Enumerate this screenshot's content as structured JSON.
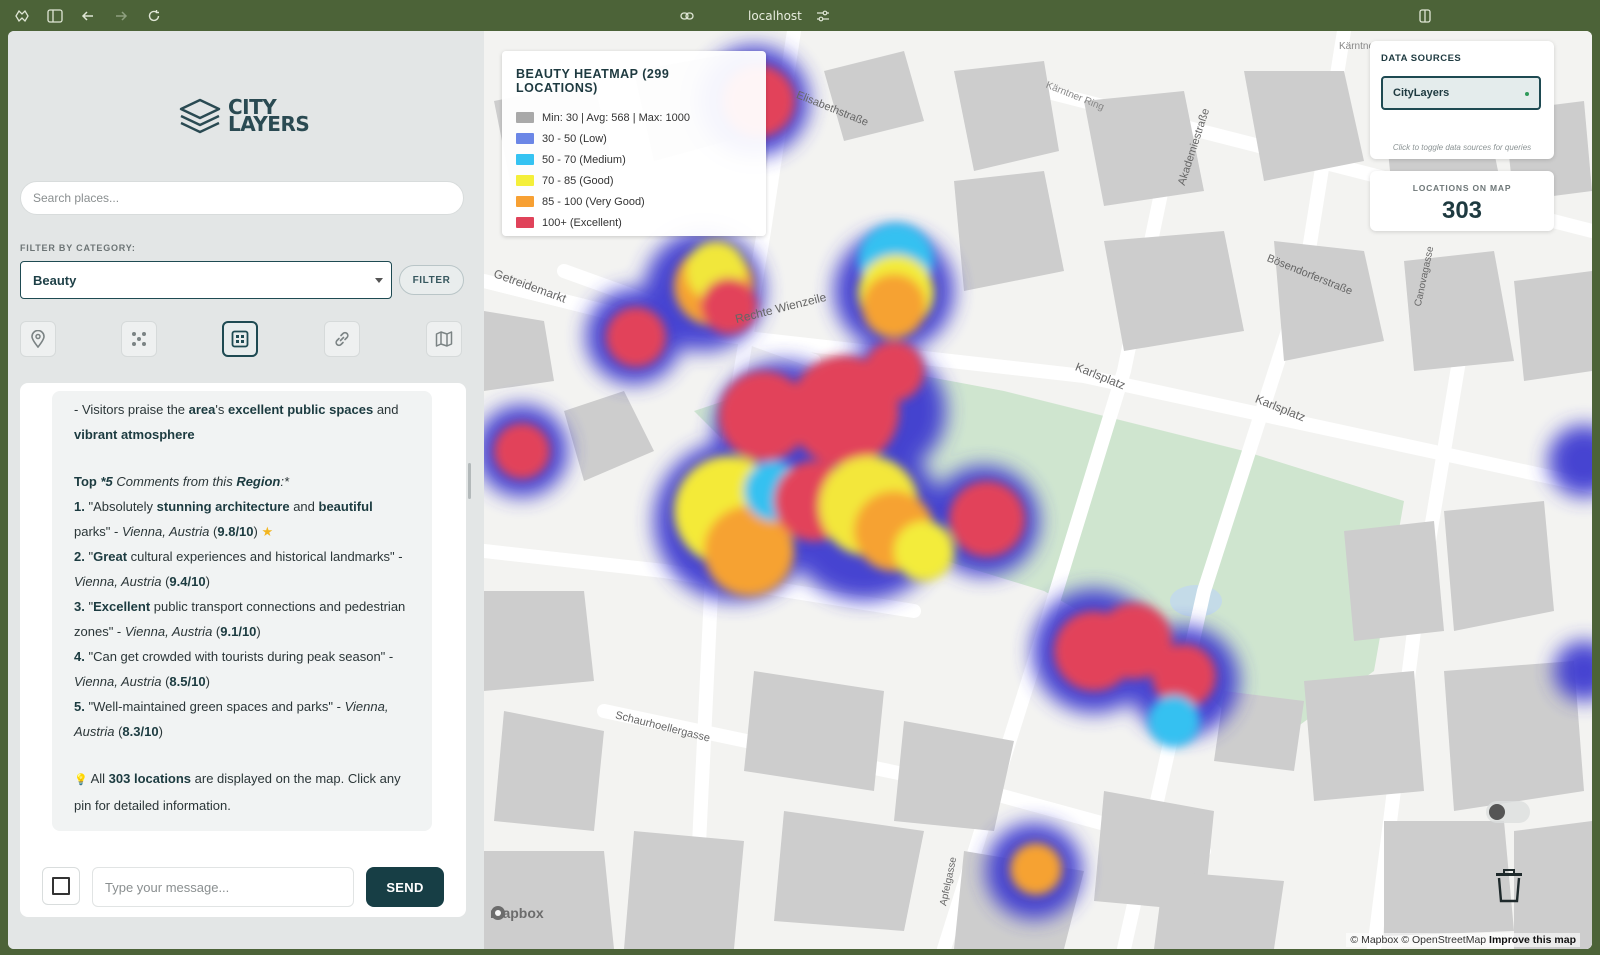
{
  "browser": {
    "url": "localhost"
  },
  "app": {
    "logo_line1": "CITY",
    "logo_line2": "LAYERS"
  },
  "sidebar": {
    "search_placeholder": "Search places...",
    "category_label": "FILTER BY CATEGORY:",
    "category_selected": "Beauty",
    "filter_button": "FILTER",
    "mode_icons": [
      "pin-icon",
      "cluster-icon",
      "heatmap-grid-icon",
      "link-icon",
      "map-icon"
    ],
    "active_mode": "heatmap-grid-icon"
  },
  "chat": {
    "intro_text_a": "- Visitors praise the ",
    "intro_b1": "area",
    "intro_text_b": "'s ",
    "intro_b2": "excellent public spaces",
    "intro_text_c": " and",
    "intro_b3": "vibrant atmosphere",
    "top_prefix": "Top ",
    "top_emph": "*5",
    "top_middle": " Comments from this ",
    "top_region": "Region",
    "top_suffix": ":*",
    "comments": [
      {
        "num": "1.",
        "q1": " \"Absolutely ",
        "b1": "stunning architecture",
        "q2": " and ",
        "b2": "beautiful",
        "q3": "parks\" - ",
        "place": "Vienna, Austria",
        "score_open": " (",
        "score": "9.8/10",
        "score_close": ")",
        "star": "★"
      },
      {
        "num": "2.",
        "q1": " \"",
        "b1": "Great",
        "q2": " cultural experiences and historical landmarks\" -",
        "place": "Vienna, Austria",
        "score_open": " (",
        "score": "9.4/10",
        "score_close": ")"
      },
      {
        "num": "3.",
        "q1": " \"",
        "b1": "Excellent",
        "q2": " public transport connections and pedestrian",
        "q3": "zones\" - ",
        "place": "Vienna, Austria",
        "score_open": " (",
        "score": "9.1/10",
        "score_close": ")"
      },
      {
        "num": "4.",
        "q1": " \"Can get crowded with tourists during peak season\" -",
        "place": "Vienna, Austria",
        "score_open": " (",
        "score": "8.5/10",
        "score_close": ")"
      },
      {
        "num": "5.",
        "q1": " \"Well-maintained green spaces and parks\" - ",
        "place_a": "Vienna,",
        "place_b": "Austria",
        "score_open": " (",
        "score": "8.3/10",
        "score_close": ")"
      }
    ],
    "footer_icon": "💡",
    "footer_a": " All ",
    "footer_b": "303 locations",
    "footer_c": " are displayed on the map. Click any",
    "footer_d": "pin for detailed information.",
    "message_placeholder": "Type your message...",
    "send_label": "SEND"
  },
  "legend": {
    "title": "BEAUTY HEATMAP (299 LOCATIONS)",
    "items": [
      {
        "color": "#a9a9a9",
        "label": "Min: 30 | Avg: 568 | Max: 1000"
      },
      {
        "color": "#6b86e6",
        "label": "30 - 50 (Low)"
      },
      {
        "color": "#35c3f2",
        "label": "50 - 70 (Medium)"
      },
      {
        "color": "#f4ef3a",
        "label": "70 - 85 (Good)"
      },
      {
        "color": "#f7a033",
        "label": "85 - 100 (Very Good)"
      },
      {
        "color": "#e0435a",
        "label": "100+ (Excellent)"
      }
    ]
  },
  "data_sources": {
    "title": "DATA SOURCES",
    "source": "CityLayers",
    "hint": "Click to toggle data sources for queries"
  },
  "locations": {
    "label": "LOCATIONS ON MAP",
    "count": "303"
  },
  "map": {
    "labels": {
      "karlsplatz": "Karlsplatz",
      "karlsplatz2": "Karlsplatz",
      "rechte": "Rechte Wienzeile",
      "getreidemarkt": "Getreidemarkt",
      "schaurhoeller": "Schaurhoellergasse",
      "bosendorfer": "Bösendorferstraße",
      "akademie": "Akademiestraße",
      "kaerntner": "Kärntner Ring",
      "kaerntner2": "Kärntner Ring",
      "elisabeth": "Elisabethstraße",
      "apfel": "Apfelgasse",
      "canova": "Canovagasse"
    },
    "attribution_a": "© Mapbox © OpenStreetMap ",
    "attribution_b": "Improve this map",
    "mapbox_logo": "mapbox"
  }
}
